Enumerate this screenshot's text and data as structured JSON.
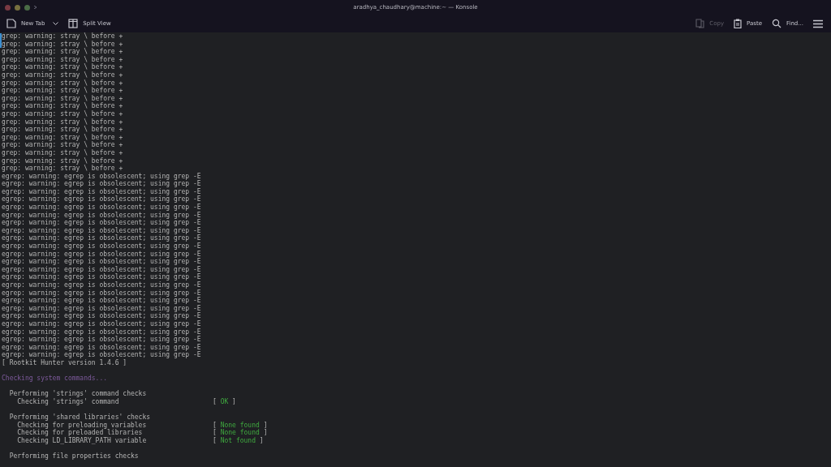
{
  "window": {
    "title": "aradhya_chaudhary@machine:~ — Konsole"
  },
  "toolbar": {
    "left": [
      {
        "label": "New Tab",
        "kind": "newtab",
        "disabled": false
      },
      {
        "label": "Split View",
        "kind": "split",
        "disabled": false
      }
    ],
    "right": [
      {
        "label": "Copy",
        "kind": "copy",
        "disabled": true
      },
      {
        "label": "Paste",
        "kind": "paste",
        "disabled": false
      },
      {
        "label": "Find...",
        "kind": "find",
        "disabled": false
      },
      {
        "kind": "menu",
        "disabled": false
      }
    ]
  },
  "terminal": {
    "lines": [
      {
        "kind": "plain",
        "text": "grep: warning: stray \\ before +"
      },
      {
        "kind": "plain",
        "text": "grep: warning: stray \\ before +"
      },
      {
        "kind": "plain",
        "text": "grep: warning: stray \\ before +"
      },
      {
        "kind": "plain",
        "text": "grep: warning: stray \\ before +"
      },
      {
        "kind": "plain",
        "text": "grep: warning: stray \\ before +"
      },
      {
        "kind": "plain",
        "text": "grep: warning: stray \\ before +"
      },
      {
        "kind": "plain",
        "text": "grep: warning: stray \\ before +"
      },
      {
        "kind": "plain",
        "text": "grep: warning: stray \\ before +"
      },
      {
        "kind": "plain",
        "text": "grep: warning: stray \\ before +"
      },
      {
        "kind": "plain",
        "text": "grep: warning: stray \\ before +"
      },
      {
        "kind": "plain",
        "text": "grep: warning: stray \\ before +"
      },
      {
        "kind": "plain",
        "text": "grep: warning: stray \\ before +"
      },
      {
        "kind": "plain",
        "text": "grep: warning: stray \\ before +"
      },
      {
        "kind": "plain",
        "text": "grep: warning: stray \\ before +"
      },
      {
        "kind": "plain",
        "text": "grep: warning: stray \\ before +"
      },
      {
        "kind": "plain",
        "text": "grep: warning: stray \\ before +"
      },
      {
        "kind": "plain",
        "text": "grep: warning: stray \\ before +"
      },
      {
        "kind": "plain",
        "text": "grep: warning: stray \\ before +"
      },
      {
        "kind": "plain",
        "text": "egrep: warning: egrep is obsolescent; using grep -E"
      },
      {
        "kind": "plain",
        "text": "egrep: warning: egrep is obsolescent; using grep -E"
      },
      {
        "kind": "plain",
        "text": "egrep: warning: egrep is obsolescent; using grep -E"
      },
      {
        "kind": "plain",
        "text": "egrep: warning: egrep is obsolescent; using grep -E"
      },
      {
        "kind": "plain",
        "text": "egrep: warning: egrep is obsolescent; using grep -E"
      },
      {
        "kind": "plain",
        "text": "egrep: warning: egrep is obsolescent; using grep -E"
      },
      {
        "kind": "plain",
        "text": "egrep: warning: egrep is obsolescent; using grep -E"
      },
      {
        "kind": "plain",
        "text": "egrep: warning: egrep is obsolescent; using grep -E"
      },
      {
        "kind": "plain",
        "text": "egrep: warning: egrep is obsolescent; using grep -E"
      },
      {
        "kind": "plain",
        "text": "egrep: warning: egrep is obsolescent; using grep -E"
      },
      {
        "kind": "plain",
        "text": "egrep: warning: egrep is obsolescent; using grep -E"
      },
      {
        "kind": "plain",
        "text": "egrep: warning: egrep is obsolescent; using grep -E"
      },
      {
        "kind": "plain",
        "text": "egrep: warning: egrep is obsolescent; using grep -E"
      },
      {
        "kind": "plain",
        "text": "egrep: warning: egrep is obsolescent; using grep -E"
      },
      {
        "kind": "plain",
        "text": "egrep: warning: egrep is obsolescent; using grep -E"
      },
      {
        "kind": "plain",
        "text": "egrep: warning: egrep is obsolescent; using grep -E"
      },
      {
        "kind": "plain",
        "text": "egrep: warning: egrep is obsolescent; using grep -E"
      },
      {
        "kind": "plain",
        "text": "egrep: warning: egrep is obsolescent; using grep -E"
      },
      {
        "kind": "plain",
        "text": "egrep: warning: egrep is obsolescent; using grep -E"
      },
      {
        "kind": "plain",
        "text": "egrep: warning: egrep is obsolescent; using grep -E"
      },
      {
        "kind": "plain",
        "text": "egrep: warning: egrep is obsolescent; using grep -E"
      },
      {
        "kind": "plain",
        "text": "egrep: warning: egrep is obsolescent; using grep -E"
      },
      {
        "kind": "plain",
        "text": "egrep: warning: egrep is obsolescent; using grep -E"
      },
      {
        "kind": "plain",
        "text": "egrep: warning: egrep is obsolescent; using grep -E"
      },
      {
        "kind": "plain",
        "text": "[ Rootkit Hunter version 1.4.6 ]"
      },
      {
        "kind": "blank"
      },
      {
        "kind": "heading",
        "text": "Checking system commands..."
      },
      {
        "kind": "blank"
      },
      {
        "kind": "plain",
        "text": "  Performing 'strings' command checks"
      },
      {
        "kind": "check",
        "text": "    Checking 'strings' command",
        "open": "[",
        "status": "OK",
        "close": "]"
      },
      {
        "kind": "blank"
      },
      {
        "kind": "plain",
        "text": "  Performing 'shared libraries' checks"
      },
      {
        "kind": "check",
        "text": "    Checking for preloading variables",
        "open": "[",
        "status": "None found",
        "close": "]"
      },
      {
        "kind": "check",
        "text": "    Checking for preloaded libraries",
        "open": "[",
        "status": "None found",
        "close": "]"
      },
      {
        "kind": "check",
        "text": "    Checking LD_LIBRARY_PATH variable",
        "open": "[",
        "status": "Not found",
        "close": "]"
      },
      {
        "kind": "blank"
      },
      {
        "kind": "plain",
        "text": "  Performing file properties checks"
      }
    ]
  }
}
